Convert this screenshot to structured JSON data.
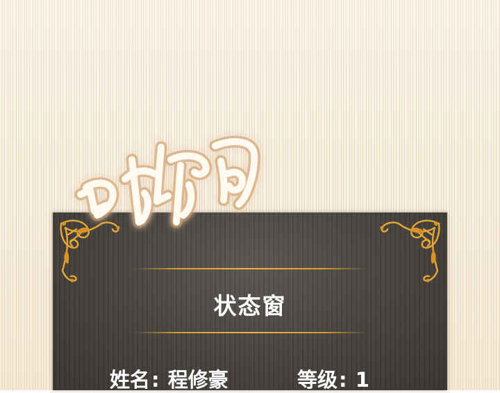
{
  "panel": {
    "title": "状态窗"
  },
  "stats": {
    "name_label": "姓名",
    "name_value": "程修豪",
    "level_label": "等级",
    "level_value": "1",
    "separator": ":"
  },
  "stamp": {
    "text": "叮咚"
  },
  "colors": {
    "background": "#f4ead6",
    "panel": "#4a4641",
    "gold": "#e8a736",
    "text": "#ffffff"
  },
  "icons": {
    "corner_ornament": "gold-filigree-ornament-icon"
  }
}
